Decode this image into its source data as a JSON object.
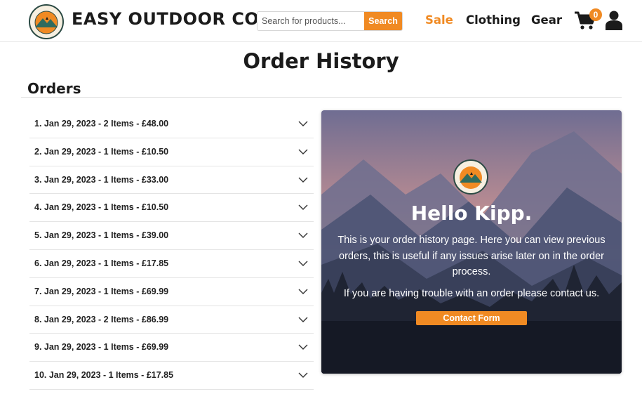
{
  "header": {
    "brand_name": "EASY OUTDOOR CO.",
    "logo_text": "EASY OUTDOOR",
    "search_placeholder": "Search for products...",
    "search_button": "Search",
    "nav": {
      "sale": "Sale",
      "clothing": "Clothing",
      "gear": "Gear"
    },
    "cart_icon": "shopping-cart-icon",
    "cart_count": "0",
    "user_icon": "user-icon"
  },
  "page": {
    "title": "Order History",
    "orders_heading": "Orders"
  },
  "orders": [
    "1. Jan 29, 2023 - 2 Items - £48.00",
    "2. Jan 29, 2023 - 1 Items - £10.50",
    "3. Jan 29, 2023 - 1 Items - £33.00",
    "4. Jan 29, 2023 - 1 Items - £10.50",
    "5. Jan 29, 2023 - 1 Items - £39.00",
    "6. Jan 29, 2023 - 1 Items - £17.85",
    "7. Jan 29, 2023 - 1 Items - £69.99",
    "8. Jan 29, 2023 - 2 Items - £86.99",
    "9. Jan 29, 2023 - 1 Items - £69.99",
    "10. Jan 29, 2023 - 1 Items - £17.85"
  ],
  "panel": {
    "greeting": "Hello Kipp.",
    "paragraph1": "This is your order history page. Here you can view previous orders, this is useful if any issues arise later on in the order process.",
    "paragraph2": "If you are having trouble with an order please contact us.",
    "contact_button": "Contact Form"
  },
  "colors": {
    "accent": "#f08a23",
    "text_dark": "#1b1b1b"
  }
}
